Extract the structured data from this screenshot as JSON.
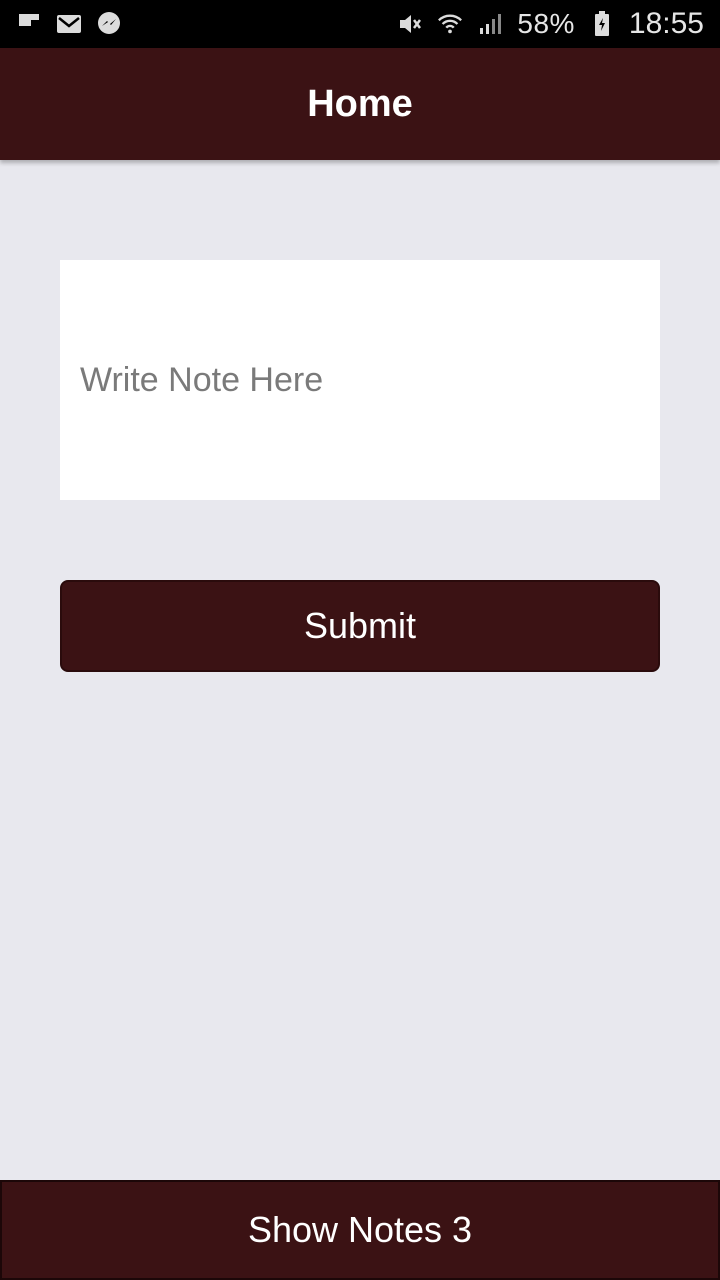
{
  "status_bar": {
    "left_icons": [
      "flipboard-icon",
      "gmail-icon",
      "messenger-icon"
    ],
    "right_icons": [
      "mute-icon",
      "wifi-icon",
      "signal-icon",
      "battery-icon"
    ],
    "battery_percent": "58%",
    "time": "18:55"
  },
  "app_bar": {
    "title": "Home"
  },
  "note_input": {
    "value": "",
    "placeholder": "Write Note Here"
  },
  "submit_button": {
    "label": "Submit"
  },
  "bottom_button": {
    "label": "Show Notes 3"
  },
  "colors": {
    "primary": "#3b1214",
    "background": "#e8e8ee",
    "input_background": "#ffffff"
  }
}
